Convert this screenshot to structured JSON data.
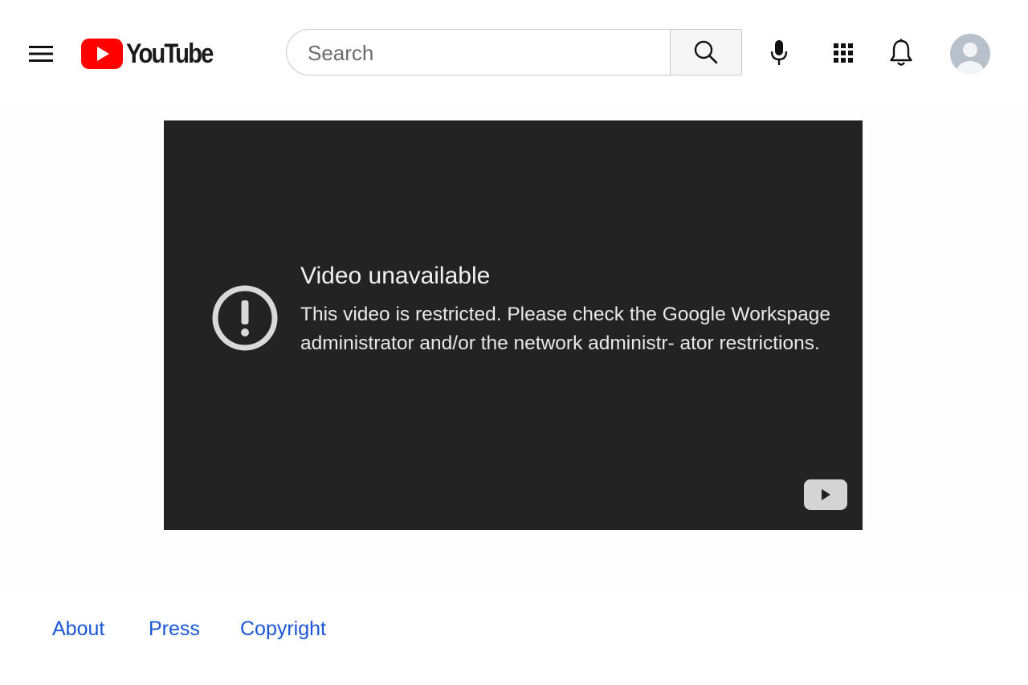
{
  "header": {
    "logo_text": "YouTube",
    "logo_color": "#ff0000",
    "search": {
      "placeholder": "Search",
      "value": ""
    },
    "icons": [
      "menu-icon",
      "search-icon",
      "microphone-icon",
      "apps-grid-icon",
      "bell-icon",
      "avatar-icon"
    ]
  },
  "player": {
    "background": "#232323",
    "error_icon": "exclamation-circle-icon",
    "title": "Video unavailable",
    "message": "This video is restricted. Please check the Google Workspage administrator and/or the network administr- ator restrictions.",
    "badge_icon": "youtube-play-icon"
  },
  "footer": {
    "links": [
      {
        "label": "About"
      },
      {
        "label": "Press"
      },
      {
        "label": "Copyright"
      }
    ],
    "link_color": "#1a56d6"
  }
}
